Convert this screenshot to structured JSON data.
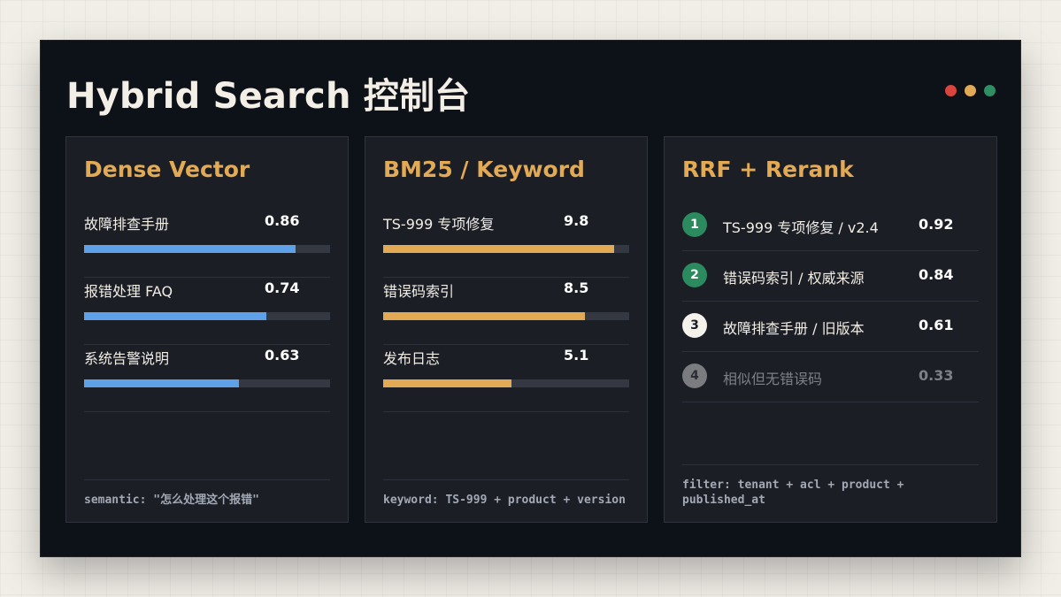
{
  "title": "Hybrid Search 控制台",
  "window_dots": [
    "#d9453d",
    "#e2aa55",
    "#2f8f62"
  ],
  "panels": {
    "dense": {
      "title": "Dense Vector",
      "bar_color": "#5ea1e8",
      "items": [
        {
          "label": "故障排查手册",
          "score": "0.86",
          "fill": 0.86
        },
        {
          "label": "报错处理 FAQ",
          "score": "0.74",
          "fill": 0.74
        },
        {
          "label": "系统告警说明",
          "score": "0.63",
          "fill": 0.63
        }
      ],
      "footer": "semantic: \"怎么处理这个报错\""
    },
    "bm25": {
      "title": "BM25 / Keyword",
      "bar_color": "#e2aa55",
      "items": [
        {
          "label": "TS-999 专项修复",
          "score": "9.8",
          "fill": 0.94
        },
        {
          "label": "错误码索引",
          "score": "8.5",
          "fill": 0.82
        },
        {
          "label": "发布日志",
          "score": "5.1",
          "fill": 0.52
        }
      ],
      "footer": "keyword: TS-999 + product + version"
    },
    "rrf": {
      "title": "RRF + Rerank",
      "items": [
        {
          "rank": "1",
          "label": "TS-999 专项修复 / v2.4",
          "score": "0.92",
          "badge_bg": "#2b8a5e",
          "badge_fg": "#ffffff",
          "dim": false
        },
        {
          "rank": "2",
          "label": "错误码索引 / 权威来源",
          "score": "0.84",
          "badge_bg": "#2b8a5e",
          "badge_fg": "#ffffff",
          "dim": false
        },
        {
          "rank": "3",
          "label": "故障排查手册 / 旧版本",
          "score": "0.61",
          "badge_bg": "#f5f2ec",
          "badge_fg": "#1b1e25",
          "dim": false
        },
        {
          "rank": "4",
          "label": "相似但无错误码",
          "score": "0.33",
          "badge_bg": "#7a7c80",
          "badge_fg": "#2a2d33",
          "dim": true
        }
      ],
      "footer": "filter: tenant + acl + product + published_at"
    }
  }
}
